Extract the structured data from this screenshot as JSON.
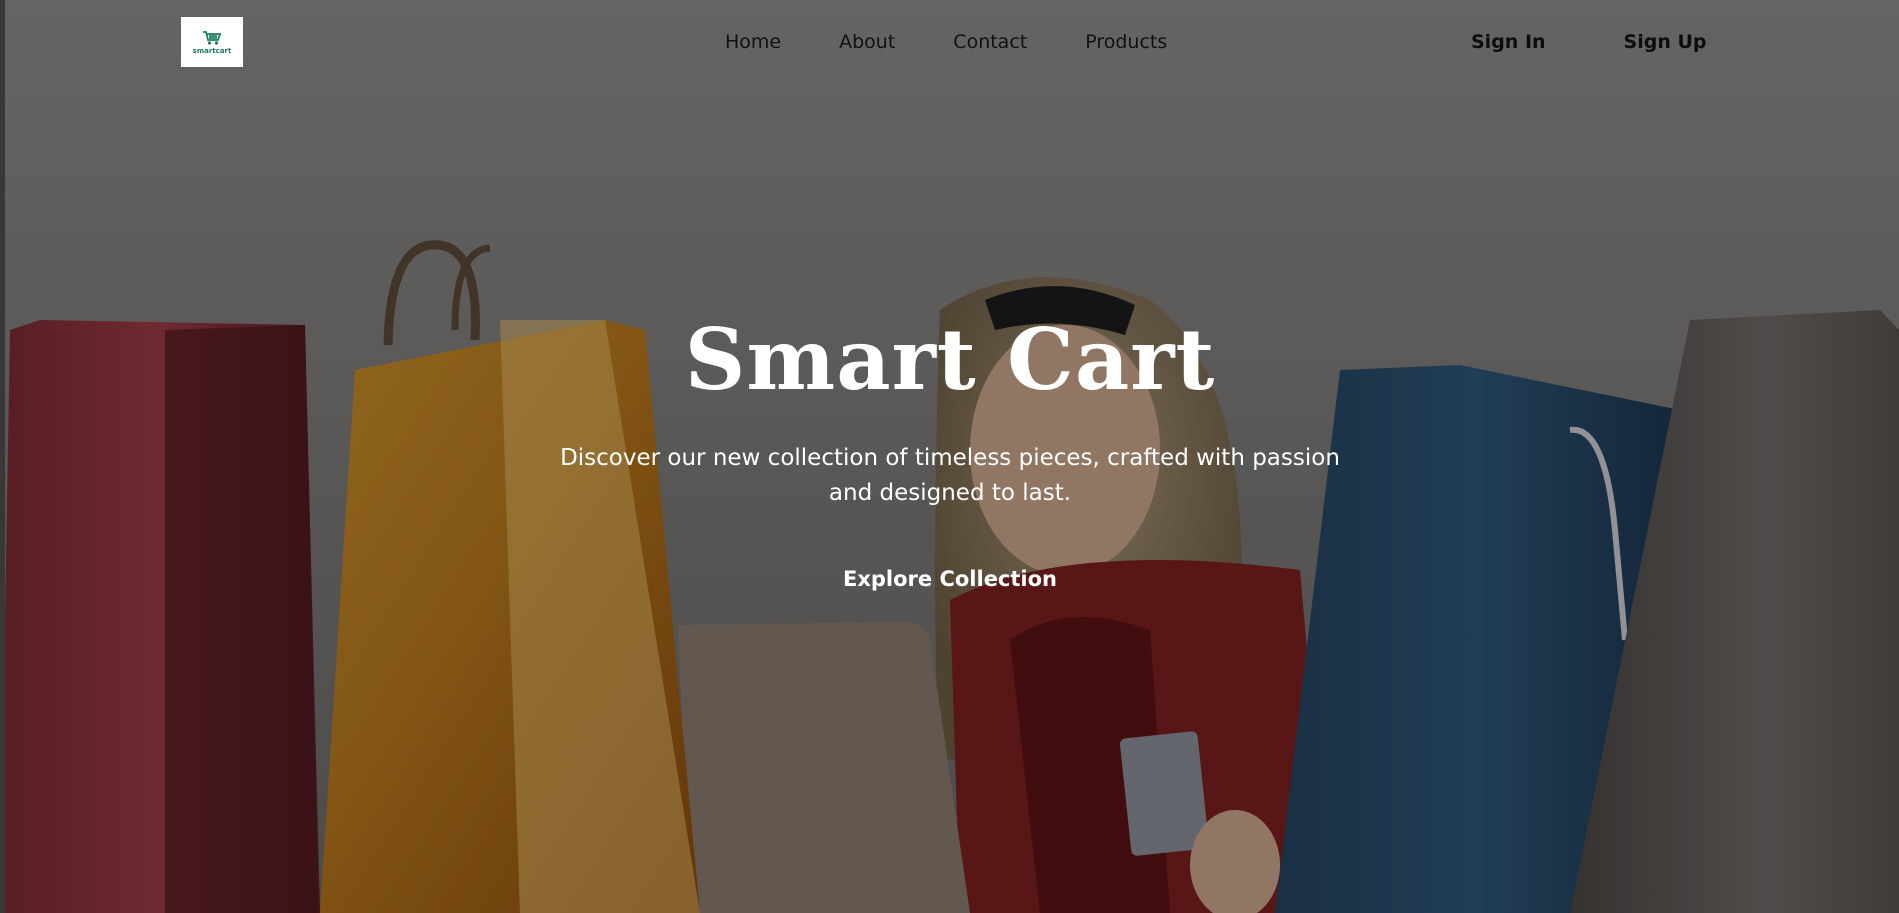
{
  "brand": {
    "logo_text": "smartcart",
    "logo_accent": "#1f7a63"
  },
  "nav": {
    "links": [
      {
        "label": "Home"
      },
      {
        "label": "About"
      },
      {
        "label": "Contact"
      },
      {
        "label": "Products"
      }
    ]
  },
  "auth": {
    "sign_in": "Sign In",
    "sign_up": "Sign Up"
  },
  "hero": {
    "title": "Smart Cart",
    "subtitle": "Discover our new collection of timeless pieces, crafted with passion and designed to last.",
    "cta": "Explore Collection",
    "background_image": "shopping-bags-woman-laptop-photo"
  },
  "colors": {
    "nav_text": "#111111",
    "hero_text": "#ffffff"
  }
}
